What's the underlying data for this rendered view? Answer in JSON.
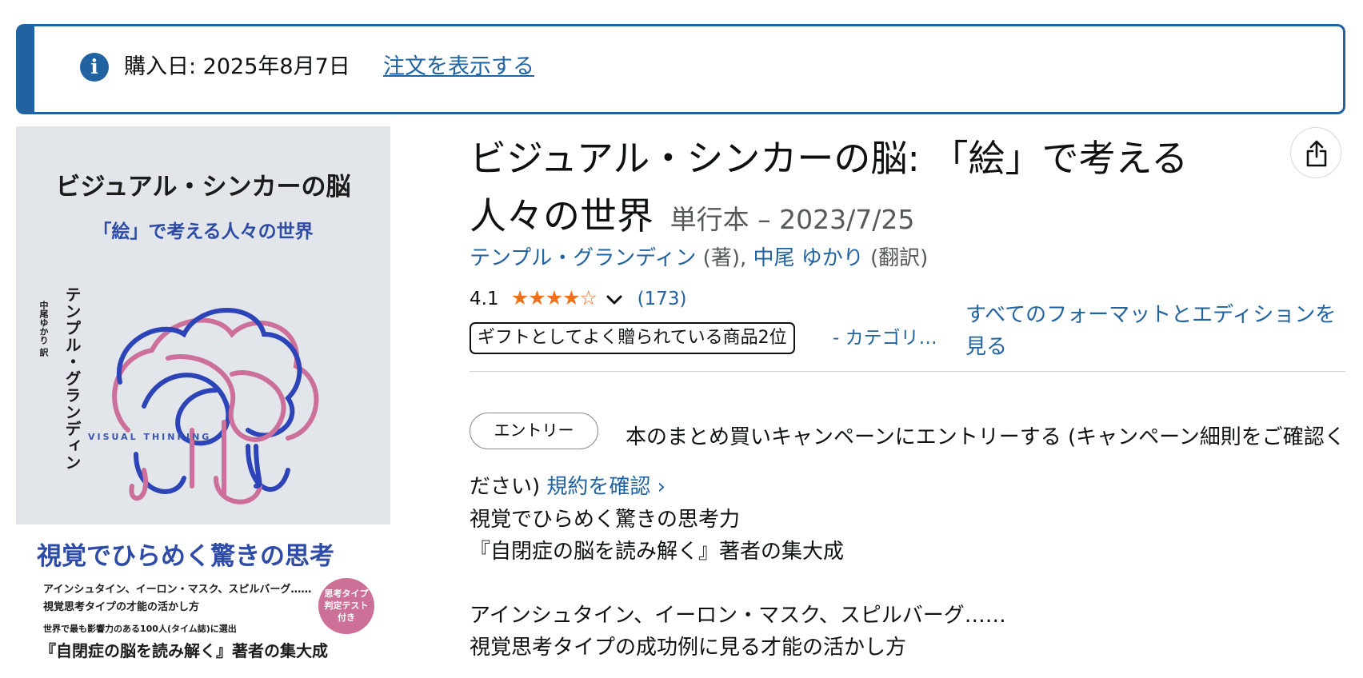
{
  "banner": {
    "icon": "info-icon",
    "purchase_date": "購入日: 2025年8月7日",
    "view_order_link": "注文を表示する",
    "accent_color": "#2162a1"
  },
  "cover": {
    "title": "ビジュアル・シンカーの脳",
    "subtitle": "「絵」で考える人々の世界",
    "author": "テンプル・グランディン",
    "translator": "中尾ゆかり 訳",
    "art_text": "VISUAL THINKING",
    "catchphrase": "視覚でひらめく驚きの思考",
    "line1": "アインシュタイン、イーロン・マスク、スピルバーグ……",
    "line2": "視覚思考タイプの才能の活かし方",
    "line3": "世界で最も影響力のある100人(タイム誌)に選出",
    "line4": "『自閉症の脳を読み解く』著者の集大成",
    "badge": [
      "思考タイプ",
      "判定テスト",
      "付き"
    ]
  },
  "product": {
    "title": "ビジュアル・シンカーの脳: 「絵」で考える人々の世界",
    "format_date": "単行本 – 2023/7/25",
    "share_icon": "share-icon",
    "author_name": "テンプル・グランディン",
    "author_role": "(著),",
    "translator_name": "中尾 ゆかり",
    "translator_role": "(翻訳)",
    "rating_value": "4.1",
    "rating_stars": 4.1,
    "stars_text": "★★★★☆",
    "rating_count": "(173)",
    "gift_badge": "ギフトとしてよく贈られている商品2位",
    "category_link": "- カテゴリ…",
    "formats_link": "すべてのフォーマットとエディションを見る",
    "star_color": "#f06f1b",
    "link_color": "#2162a1"
  },
  "campaign": {
    "entry_button": "エントリー",
    "text": "本のまとめ買いキャンペーンにエントリーする (キャンペーン細則をご確認ください)",
    "terms_link": "規約を確認 ›"
  },
  "description": {
    "line1": "視覚でひらめく驚きの思考力",
    "line2": "『自閉症の脳を読み解く』著者の集大成",
    "line3": "アインシュタイン、イーロン・マスク、スピルバーグ……",
    "line4": "視覚思考タイプの成功例に見る才能の活かし方"
  }
}
